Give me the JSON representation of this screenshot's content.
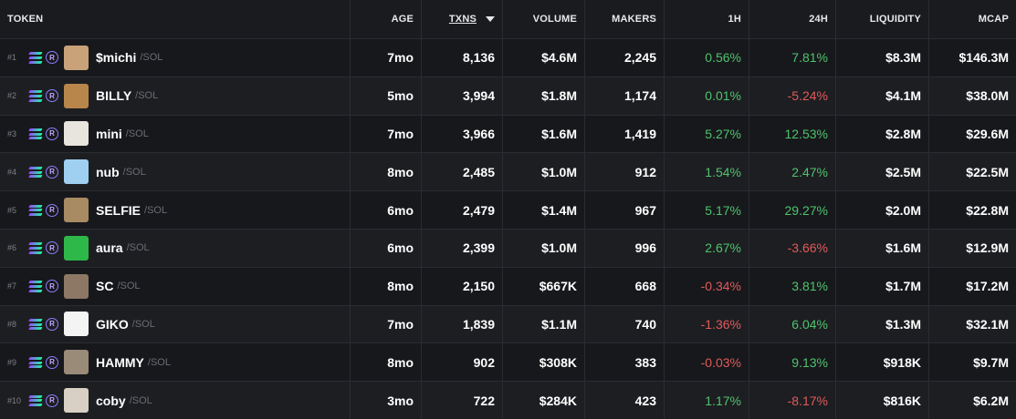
{
  "header": {
    "token": "TOKEN",
    "age": "AGE",
    "txns": "TXNS",
    "volume": "VOLUME",
    "makers": "MAKERS",
    "h1": "1H",
    "h24": "24H",
    "liquidity": "LIQUIDITY",
    "mcap": "MCAP"
  },
  "colors": {
    "positive": "#4fc36c",
    "negative": "#e05a5a",
    "row_odd": "#17181c",
    "row_even": "#1d1e22"
  },
  "rows": [
    {
      "rank": "#1",
      "symbol": "$michi",
      "chain": "/SOL",
      "age": "7mo",
      "txns": "8,136",
      "volume": "$4.6M",
      "makers": "2,245",
      "h1": "0.56%",
      "h24": "7.81%",
      "liquidity": "$8.3M",
      "mcap": "$146.3M",
      "avatar_color": "#c9a27a",
      "icons": [
        "solana-icon",
        "raydium-icon"
      ]
    },
    {
      "rank": "#2",
      "symbol": "BILLY",
      "chain": "/SOL",
      "age": "5mo",
      "txns": "3,994",
      "volume": "$1.8M",
      "makers": "1,174",
      "h1": "0.01%",
      "h24": "-5.24%",
      "liquidity": "$4.1M",
      "mcap": "$38.0M",
      "avatar_color": "#b8864b",
      "icons": [
        "solana-icon",
        "raydium-icon"
      ]
    },
    {
      "rank": "#3",
      "symbol": "mini",
      "chain": "/SOL",
      "age": "7mo",
      "txns": "3,966",
      "volume": "$1.6M",
      "makers": "1,419",
      "h1": "5.27%",
      "h24": "12.53%",
      "liquidity": "$2.8M",
      "mcap": "$29.6M",
      "avatar_color": "#e8e4de",
      "icons": [
        "solana-icon",
        "raydium-icon"
      ]
    },
    {
      "rank": "#4",
      "symbol": "nub",
      "chain": "/SOL",
      "age": "8mo",
      "txns": "2,485",
      "volume": "$1.0M",
      "makers": "912",
      "h1": "1.54%",
      "h24": "2.47%",
      "liquidity": "$2.5M",
      "mcap": "$22.5M",
      "avatar_color": "#9fd0f2",
      "icons": [
        "solana-icon",
        "raydium-icon"
      ]
    },
    {
      "rank": "#5",
      "symbol": "SELFIE",
      "chain": "/SOL",
      "age": "6mo",
      "txns": "2,479",
      "volume": "$1.4M",
      "makers": "967",
      "h1": "5.17%",
      "h24": "29.27%",
      "liquidity": "$2.0M",
      "mcap": "$22.8M",
      "avatar_color": "#a88a63",
      "icons": [
        "solana-icon",
        "raydium-icon"
      ]
    },
    {
      "rank": "#6",
      "symbol": "aura",
      "chain": "/SOL",
      "age": "6mo",
      "txns": "2,399",
      "volume": "$1.0M",
      "makers": "996",
      "h1": "2.67%",
      "h24": "-3.66%",
      "liquidity": "$1.6M",
      "mcap": "$12.9M",
      "avatar_color": "#2fb84a",
      "icons": [
        "solana-icon",
        "raydium-icon"
      ]
    },
    {
      "rank": "#7",
      "symbol": "SC",
      "chain": "/SOL",
      "age": "8mo",
      "txns": "2,150",
      "volume": "$667K",
      "makers": "668",
      "h1": "-0.34%",
      "h24": "3.81%",
      "liquidity": "$1.7M",
      "mcap": "$17.2M",
      "avatar_color": "#8c7865",
      "icons": [
        "solana-icon",
        "raydium-icon"
      ]
    },
    {
      "rank": "#8",
      "symbol": "GIKO",
      "chain": "/SOL",
      "age": "7mo",
      "txns": "1,839",
      "volume": "$1.1M",
      "makers": "740",
      "h1": "-1.36%",
      "h24": "6.04%",
      "liquidity": "$1.3M",
      "mcap": "$32.1M",
      "avatar_color": "#f4f4f4",
      "icons": [
        "solana-icon",
        "raydium-icon"
      ]
    },
    {
      "rank": "#9",
      "symbol": "HAMMY",
      "chain": "/SOL",
      "age": "8mo",
      "txns": "902",
      "volume": "$308K",
      "makers": "383",
      "h1": "-0.03%",
      "h24": "9.13%",
      "liquidity": "$918K",
      "mcap": "$9.7M",
      "avatar_color": "#9a8a78",
      "icons": [
        "solana-icon",
        "raydium-icon"
      ]
    },
    {
      "rank": "#10",
      "symbol": "coby",
      "chain": "/SOL",
      "age": "3mo",
      "txns": "722",
      "volume": "$284K",
      "makers": "423",
      "h1": "1.17%",
      "h24": "-8.17%",
      "liquidity": "$816K",
      "mcap": "$6.2M",
      "avatar_color": "#d8d0c4",
      "icons": [
        "solana-icon",
        "raydium-icon"
      ]
    }
  ]
}
